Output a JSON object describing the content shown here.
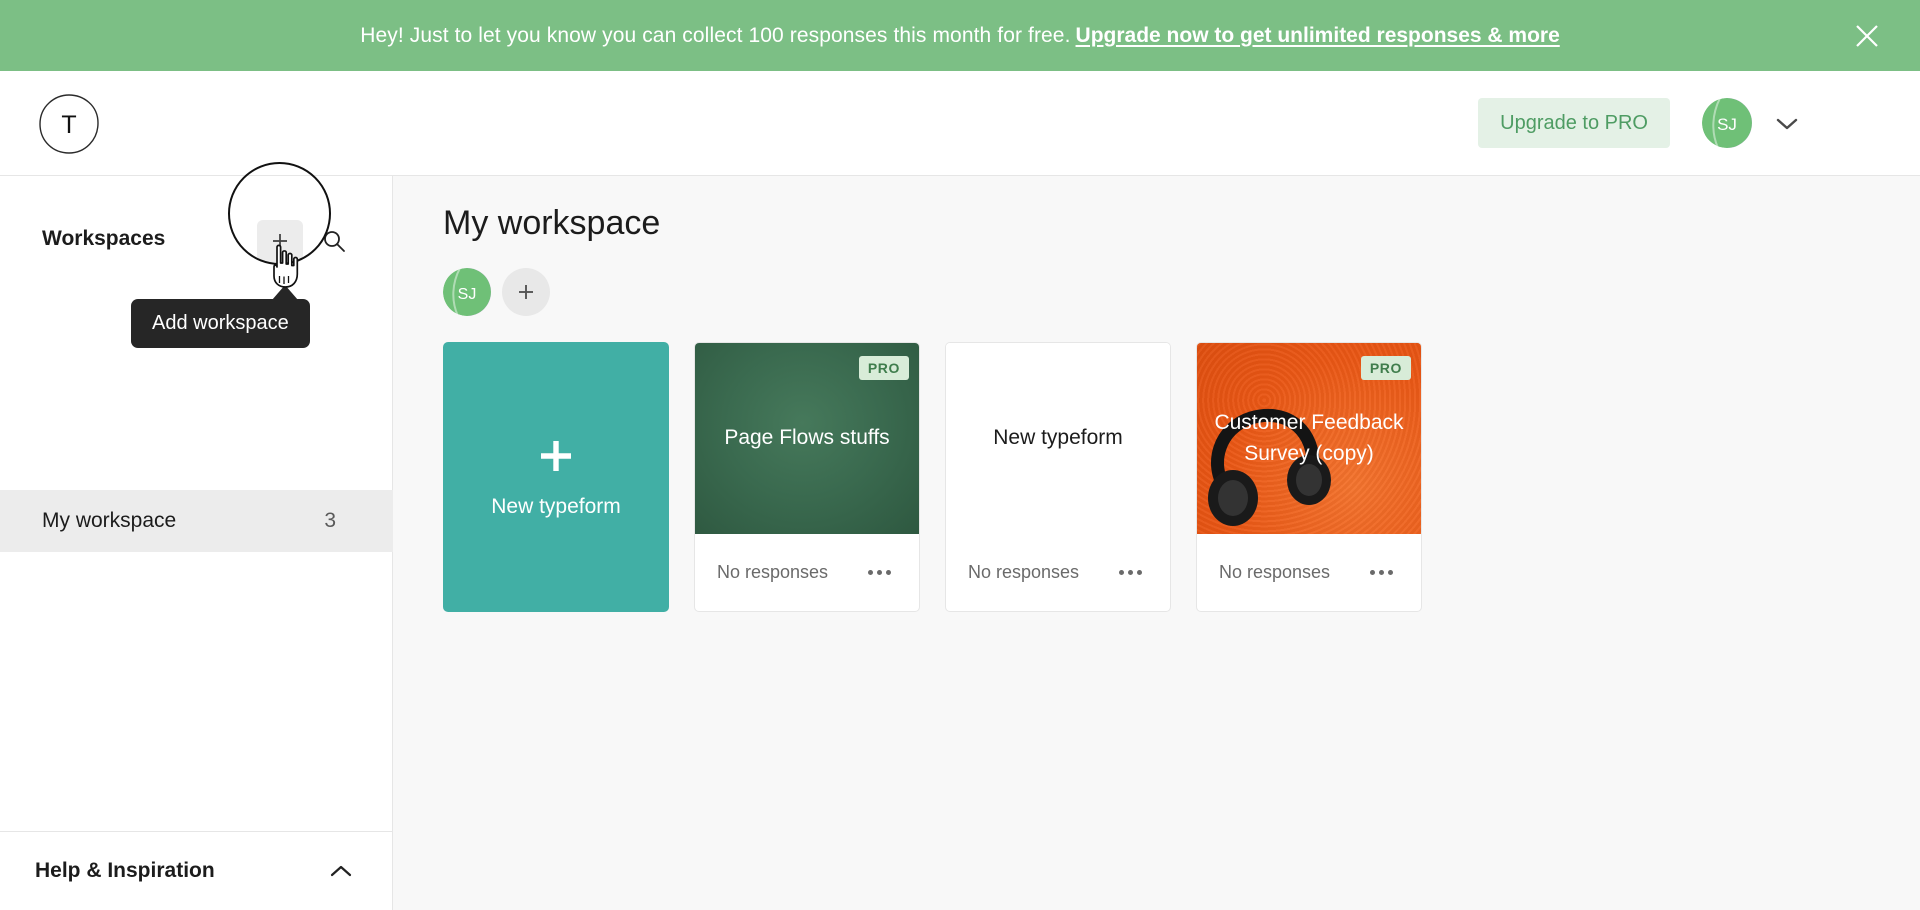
{
  "banner": {
    "message": "Hey! Just to let you know you can collect 100 responses this month for free.",
    "link_text": "Upgrade now to get unlimited responses & more",
    "close_icon": "close-icon",
    "background_color": "#7CBF85"
  },
  "header": {
    "logo_letter": "T",
    "logo_icon": "typeform-logo-icon",
    "upgrade_label": "Upgrade to PRO",
    "avatar_initials": "SJ",
    "caret_icon": "chevron-down-icon"
  },
  "sidebar": {
    "title": "Workspaces",
    "add_icon": "plus-icon",
    "search_icon": "search-icon",
    "workspaces": [
      {
        "name": "My workspace",
        "count": "3"
      }
    ],
    "footer_label": "Help & Inspiration",
    "footer_caret_icon": "chevron-up-icon"
  },
  "tooltip": {
    "text": "Add workspace"
  },
  "cursor": {
    "icon": "pointing-hand-cursor"
  },
  "main": {
    "title": "My workspace",
    "member_avatar_initials": "SJ",
    "add_member_icon": "plus-icon",
    "new_typeform": {
      "label": "New typeform",
      "plus_icon": "plus-icon",
      "color": "#41AFA5"
    },
    "cards": [
      {
        "title": "Page Flows stuffs",
        "status": "No responses",
        "badge": "PRO",
        "thumb_style": "green",
        "menu_icon": "more-options-icon"
      },
      {
        "title": "New typeform",
        "status": "No responses",
        "badge": "",
        "thumb_style": "white",
        "menu_icon": "more-options-icon"
      },
      {
        "title": "Customer Feedback Survey (copy)",
        "status": "No responses",
        "badge": "PRO",
        "thumb_style": "orange",
        "menu_icon": "more-options-icon"
      }
    ]
  }
}
